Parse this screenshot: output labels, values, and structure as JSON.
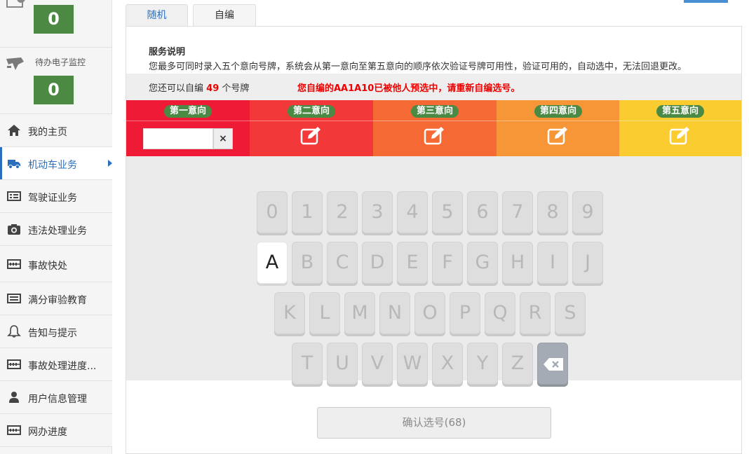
{
  "sidebar": {
    "widgets": [
      {
        "label": "",
        "count": "0",
        "icon": "todo-icon"
      },
      {
        "label": "待办电子监控",
        "count": "0",
        "icon": "camera-flag-icon"
      }
    ],
    "items": [
      {
        "label": "我的主页",
        "icon": "home-icon"
      },
      {
        "label": "机动车业务",
        "icon": "truck-icon",
        "active": true
      },
      {
        "label": "驾驶证业务",
        "icon": "card-icon"
      },
      {
        "label": "违法处理业务",
        "icon": "camera-icon"
      },
      {
        "label": "事故快处",
        "icon": "abacus-icon"
      },
      {
        "label": "满分审验教育",
        "icon": "list-icon"
      },
      {
        "label": "告知与提示",
        "icon": "bell-icon"
      },
      {
        "label": "事故处理进度...",
        "icon": "abacus-icon"
      },
      {
        "label": "用户信息管理",
        "icon": "user-icon"
      },
      {
        "label": "网办进度",
        "icon": "abacus-icon"
      }
    ]
  },
  "tabs": [
    "随机",
    "自编"
  ],
  "service": {
    "title": "服务说明",
    "desc": "您最多可同时录入五个意向号牌，系统会从第一意向至第五意向的顺序依次验证号牌可用性，验证可用的，自动选中，无法回退更改。"
  },
  "remain": {
    "prefix": "您还可以自编",
    "num": "49",
    "suffix": "个号牌"
  },
  "warning": "您自编的AA1A10已被他人预选中，请重新自编选号。",
  "intents": [
    {
      "label": "第一意向",
      "color": "#ee1a36"
    },
    {
      "label": "第二意向",
      "color": "#f3383a"
    },
    {
      "label": "第三意向",
      "color": "#f56a34"
    },
    {
      "label": "第四意向",
      "color": "#f69636"
    },
    {
      "label": "第五意向",
      "color": "#fbcc30"
    }
  ],
  "plate_input": {
    "value": "",
    "clear_label": "×"
  },
  "keyboard": {
    "row1": [
      "0",
      "1",
      "2",
      "3",
      "4",
      "5",
      "6",
      "7",
      "8",
      "9"
    ],
    "row2": [
      "A",
      "B",
      "C",
      "D",
      "E",
      "F",
      "G",
      "H",
      "I",
      "J"
    ],
    "row3": [
      "K",
      "L",
      "M",
      "N",
      "O",
      "P",
      "Q",
      "R",
      "S"
    ],
    "row4": [
      "T",
      "U",
      "V",
      "W",
      "X",
      "Y",
      "Z"
    ],
    "enabled": [
      "A"
    ],
    "backspace_icon": "backspace-icon"
  },
  "confirm_label": "确认选号(68)"
}
